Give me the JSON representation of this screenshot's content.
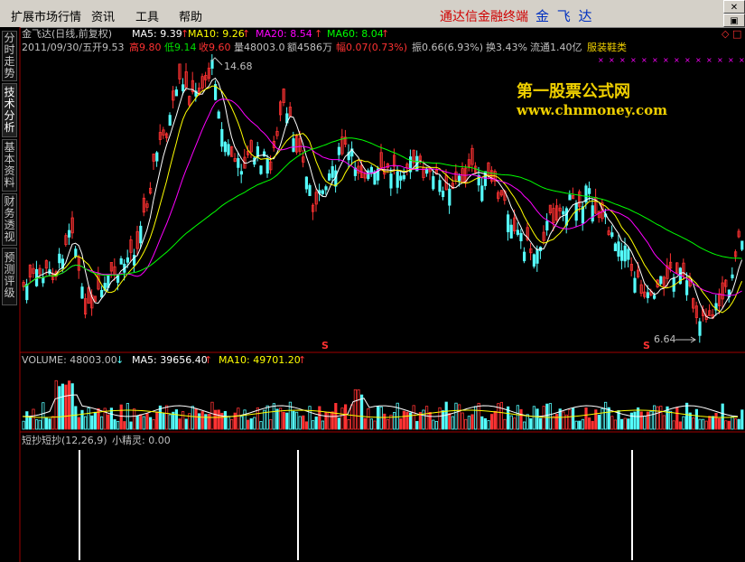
{
  "menu": {
    "items": [
      "扩展市场行情",
      "资讯",
      "工具",
      "帮助"
    ],
    "app_title": "通达信金融终端",
    "stock_name": "金 飞 达"
  },
  "side_tabs": [
    "分时走势",
    "技术分析",
    "基本资料",
    "财务透视",
    "预测评级"
  ],
  "header": {
    "title": "金飞达(日线,前复权)",
    "ma5": "MA5: 9.39",
    "ma10": "MA10: 9.26",
    "ma20": "MA20: 8.54",
    "ma60": "MA60: 8.04"
  },
  "info_line": {
    "date": "2011/09/30/五",
    "open": "开9.53",
    "high": "高9.80",
    "low": "低9.14",
    "close": "收9.60",
    "volume": "量48003.0",
    "amount": "额4586万",
    "change": "幅0.07(0.73%)",
    "amplitude": "振0.66(6.93%)",
    "turnover": "换3.43%",
    "float": "流通1.40亿",
    "sector": "服装鞋类"
  },
  "price_panel": {
    "high_label": "14.68",
    "low_label": "6.64",
    "marker": "S",
    "watermark_cn": "第一股票公式网",
    "watermark_url": "www.chnmoney.com"
  },
  "volume_panel": {
    "volume": "VOLUME: 48003.00",
    "ma5": "MA5: 39656.40",
    "ma10": "MA10: 49701.20"
  },
  "indicator_panel": {
    "name": "短抄短抄(12,26,9)",
    "value": "小精灵: 0.00"
  },
  "colors": {
    "up": "#ff3232",
    "down": "#54fcfc",
    "ma5": "#ffffff",
    "ma10": "#ffff00",
    "ma20": "#ff00ff",
    "ma60": "#00ff00",
    "grid": "#a00000"
  }
}
